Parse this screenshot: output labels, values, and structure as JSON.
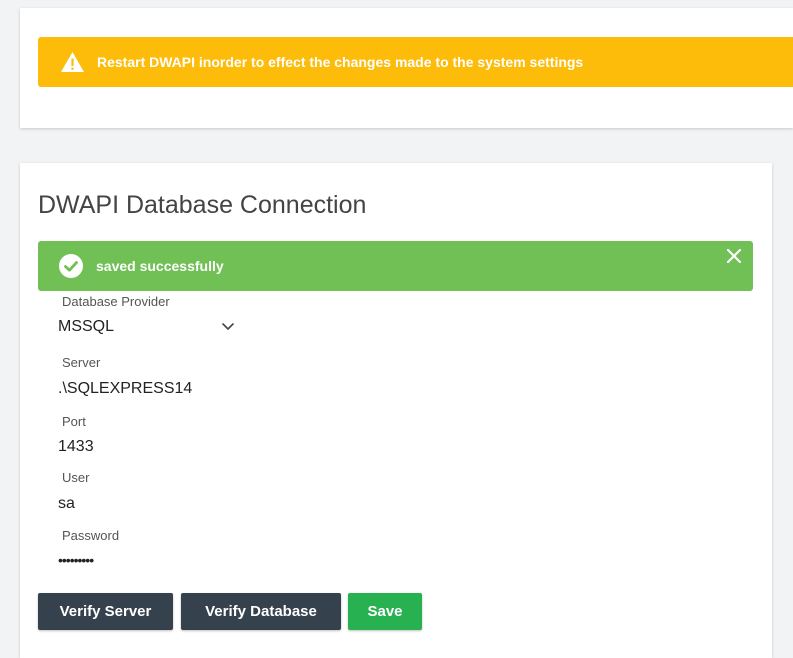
{
  "warning": {
    "icon": "warning-triangle-icon",
    "text": "Restart DWAPI inorder to effect the changes made to the system settings",
    "color": "#fdbb0a"
  },
  "db_card": {
    "title": "DWAPI Database Connection",
    "alert": {
      "icon": "check-circle-icon",
      "text": "saved successfully",
      "color": "#71c055",
      "close_icon": "close-icon"
    },
    "fields": {
      "provider": {
        "label": "Database Provider",
        "value": "MSSQL"
      },
      "server": {
        "label": "Server",
        "value": ".\\SQLEXPRESS14"
      },
      "port": {
        "label": "Port",
        "value": "1433"
      },
      "user": {
        "label": "User",
        "value": "sa"
      },
      "password": {
        "label": "Password",
        "value": "•••••••••"
      }
    },
    "buttons": {
      "verify_server": "Verify Server",
      "verify_database": "Verify Database",
      "save": "Save"
    },
    "colors": {
      "dark_button": "#35424e",
      "save_button": "#28b151"
    }
  }
}
